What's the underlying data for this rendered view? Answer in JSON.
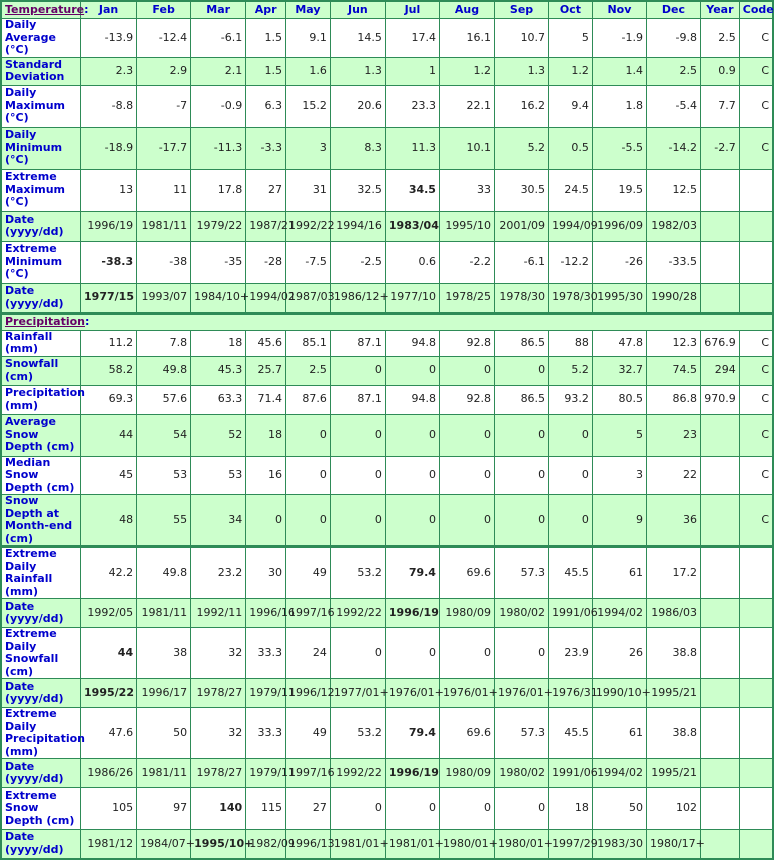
{
  "header": {
    "temperature_section": "Temperature",
    "precipitation_section": "Precipitation",
    "colon": ":",
    "months": [
      "Jan",
      "Feb",
      "Mar",
      "Apr",
      "May",
      "Jun",
      "Jul",
      "Aug",
      "Sep",
      "Oct",
      "Nov",
      "Dec"
    ],
    "year": "Year",
    "code": "Code"
  },
  "temperature_rows": [
    {
      "label": "Daily Average (°C)",
      "values": [
        "-13.9",
        "-12.4",
        "-6.1",
        "1.5",
        "9.1",
        "14.5",
        "17.4",
        "16.1",
        "10.7",
        "5",
        "-1.9",
        "-9.8"
      ],
      "year": "2.5",
      "code": "C",
      "bold": []
    },
    {
      "label": "Standard Deviation",
      "values": [
        "2.3",
        "2.9",
        "2.1",
        "1.5",
        "1.6",
        "1.3",
        "1",
        "1.2",
        "1.3",
        "1.2",
        "1.4",
        "2.5"
      ],
      "year": "0.9",
      "code": "C",
      "bold": []
    },
    {
      "label": "Daily Maximum (°C)",
      "values": [
        "-8.8",
        "-7",
        "-0.9",
        "6.3",
        "15.2",
        "20.6",
        "23.3",
        "22.1",
        "16.2",
        "9.4",
        "1.8",
        "-5.4"
      ],
      "year": "7.7",
      "code": "C",
      "bold": []
    },
    {
      "label": "Daily Minimum (°C)",
      "values": [
        "-18.9",
        "-17.7",
        "-11.3",
        "-3.3",
        "3",
        "8.3",
        "11.3",
        "10.1",
        "5.2",
        "0.5",
        "-5.5",
        "-14.2"
      ],
      "year": "-2.7",
      "code": "C",
      "bold": []
    },
    {
      "label": "Extreme Maximum (°C)",
      "values": [
        "13",
        "11",
        "17.8",
        "27",
        "31",
        "32.5",
        "34.5",
        "33",
        "30.5",
        "24.5",
        "19.5",
        "12.5"
      ],
      "year": "",
      "code": "",
      "bold": [
        6
      ]
    },
    {
      "label": "Date (yyyy/dd)",
      "values": [
        "1996/19",
        "1981/11",
        "1979/22",
        "1987/21",
        "1992/22",
        "1994/16",
        "1983/04",
        "1995/10",
        "2001/09",
        "1994/09",
        "1996/09",
        "1982/03"
      ],
      "year": "",
      "code": "",
      "bold": [
        6
      ]
    },
    {
      "label": "Extreme Minimum (°C)",
      "values": [
        "-38.3",
        "-38",
        "-35",
        "-28",
        "-7.5",
        "-2.5",
        "0.6",
        "-2.2",
        "-6.1",
        "-12.2",
        "-26",
        "-33.5"
      ],
      "year": "",
      "code": "",
      "bold": [
        0
      ]
    },
    {
      "label": "Date (yyyy/dd)",
      "values": [
        "1977/15",
        "1993/07",
        "1984/10+",
        "1994/02",
        "1987/03",
        "1986/12+",
        "1977/10",
        "1978/25",
        "1978/30",
        "1978/30",
        "1995/30",
        "1990/28"
      ],
      "year": "",
      "code": "",
      "bold": [
        0
      ]
    }
  ],
  "precipitation_rows": [
    {
      "label": "Rainfall (mm)",
      "values": [
        "11.2",
        "7.8",
        "18",
        "45.6",
        "85.1",
        "87.1",
        "94.8",
        "92.8",
        "86.5",
        "88",
        "47.8",
        "12.3"
      ],
      "year": "676.9",
      "code": "C",
      "bold": []
    },
    {
      "label": "Snowfall (cm)",
      "values": [
        "58.2",
        "49.8",
        "45.3",
        "25.7",
        "2.5",
        "0",
        "0",
        "0",
        "0",
        "5.2",
        "32.7",
        "74.5"
      ],
      "year": "294",
      "code": "C",
      "bold": []
    },
    {
      "label": "Precipitation (mm)",
      "values": [
        "69.3",
        "57.6",
        "63.3",
        "71.4",
        "87.6",
        "87.1",
        "94.8",
        "92.8",
        "86.5",
        "93.2",
        "80.5",
        "86.8"
      ],
      "year": "970.9",
      "code": "C",
      "bold": []
    },
    {
      "label": "Average Snow Depth (cm)",
      "values": [
        "44",
        "54",
        "52",
        "18",
        "0",
        "0",
        "0",
        "0",
        "0",
        "0",
        "5",
        "23"
      ],
      "year": "",
      "code": "C",
      "bold": []
    },
    {
      "label": "Median Snow Depth (cm)",
      "values": [
        "45",
        "53",
        "53",
        "16",
        "0",
        "0",
        "0",
        "0",
        "0",
        "0",
        "3",
        "22"
      ],
      "year": "",
      "code": "C",
      "bold": []
    },
    {
      "label": "Snow Depth at Month-end (cm)",
      "values": [
        "48",
        "55",
        "34",
        "0",
        "0",
        "0",
        "0",
        "0",
        "0",
        "0",
        "9",
        "36"
      ],
      "year": "",
      "code": "C",
      "bold": []
    }
  ],
  "extreme_rows": [
    {
      "label": "Extreme Daily Rainfall (mm)",
      "values": [
        "42.2",
        "49.8",
        "23.2",
        "30",
        "49",
        "53.2",
        "79.4",
        "69.6",
        "57.3",
        "45.5",
        "61",
        "17.2"
      ],
      "year": "",
      "code": "",
      "bold": [
        6
      ]
    },
    {
      "label": "Date (yyyy/dd)",
      "values": [
        "1992/05",
        "1981/11",
        "1992/11",
        "1996/16",
        "1997/16",
        "1992/22",
        "1996/19",
        "1980/09",
        "1980/02",
        "1991/06",
        "1994/02",
        "1986/03"
      ],
      "year": "",
      "code": "",
      "bold": [
        6
      ]
    },
    {
      "label": "Extreme Daily Snowfall (cm)",
      "values": [
        "44",
        "38",
        "32",
        "33.3",
        "24",
        "0",
        "0",
        "0",
        "0",
        "23.9",
        "26",
        "38.8"
      ],
      "year": "",
      "code": "",
      "bold": [
        0
      ]
    },
    {
      "label": "Date (yyyy/dd)",
      "values": [
        "1995/22",
        "1996/17",
        "1978/27",
        "1979/11",
        "1996/12",
        "1977/01+",
        "1976/01+",
        "1976/01+",
        "1976/01+",
        "1976/31",
        "1990/10+",
        "1995/21"
      ],
      "year": "",
      "code": "",
      "bold": [
        0
      ]
    },
    {
      "label": "Extreme Daily Precipitation (mm)",
      "values": [
        "47.6",
        "50",
        "32",
        "33.3",
        "49",
        "53.2",
        "79.4",
        "69.6",
        "57.3",
        "45.5",
        "61",
        "38.8"
      ],
      "year": "",
      "code": "",
      "bold": [
        6
      ]
    },
    {
      "label": "Date (yyyy/dd)",
      "values": [
        "1986/26",
        "1981/11",
        "1978/27",
        "1979/11",
        "1997/16",
        "1992/22",
        "1996/19",
        "1980/09",
        "1980/02",
        "1991/06",
        "1994/02",
        "1995/21"
      ],
      "year": "",
      "code": "",
      "bold": [
        6
      ]
    },
    {
      "label": "Extreme Snow Depth (cm)",
      "values": [
        "105",
        "97",
        "140",
        "115",
        "27",
        "0",
        "0",
        "0",
        "0",
        "18",
        "50",
        "102"
      ],
      "year": "",
      "code": "",
      "bold": [
        2
      ]
    },
    {
      "label": "Date (yyyy/dd)",
      "values": [
        "1981/12",
        "1984/07+",
        "1995/10+",
        "1982/09",
        "1996/13",
        "1981/01+",
        "1981/01+",
        "1980/01+",
        "1980/01+",
        "1997/29",
        "1983/30",
        "1980/17+"
      ],
      "year": "",
      "code": "",
      "bold": [
        2
      ]
    }
  ]
}
